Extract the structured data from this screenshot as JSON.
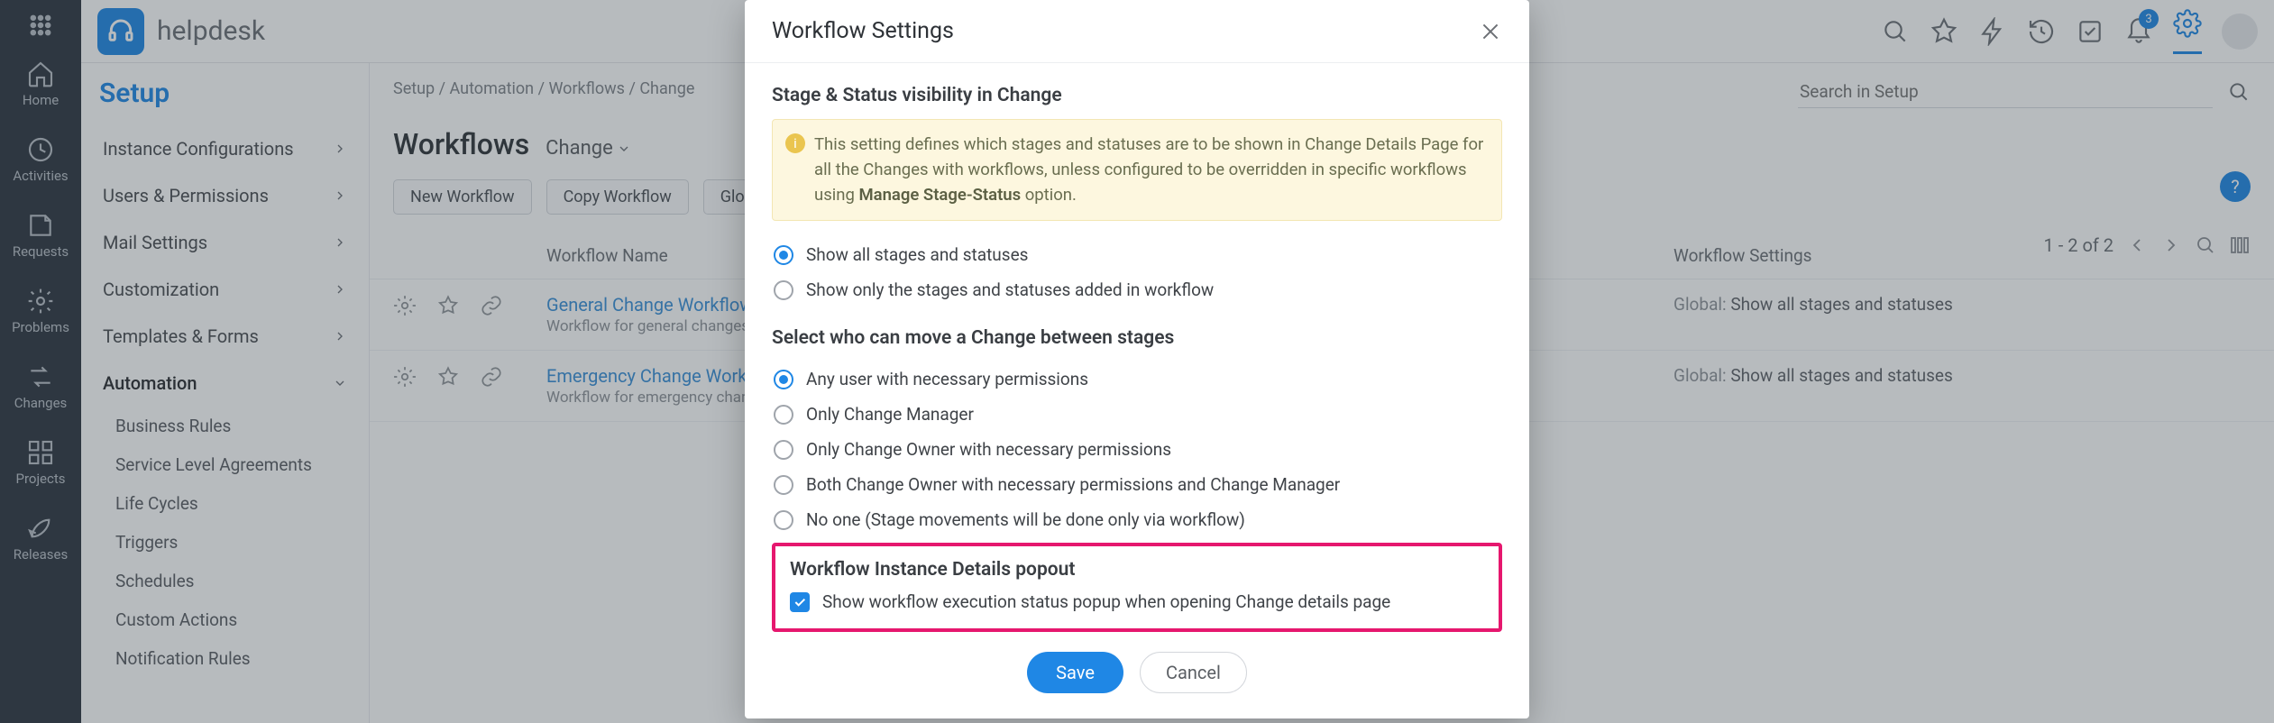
{
  "app": {
    "name": "helpdesk",
    "notif_count": "3"
  },
  "rail": {
    "items": [
      {
        "label": "Home"
      },
      {
        "label": "Activities"
      },
      {
        "label": "Requests"
      },
      {
        "label": "Problems"
      },
      {
        "label": "Changes"
      },
      {
        "label": "Projects"
      },
      {
        "label": "Releases"
      }
    ]
  },
  "sidebar": {
    "title": "Setup",
    "groups": [
      {
        "label": "Instance Configurations"
      },
      {
        "label": "Users & Permissions"
      },
      {
        "label": "Mail Settings"
      },
      {
        "label": "Customization"
      },
      {
        "label": "Templates & Forms"
      },
      {
        "label": "Automation"
      }
    ],
    "subitems": [
      "Business Rules",
      "Service Level Agreements",
      "Life Cycles",
      "Triggers",
      "Schedules",
      "Custom Actions",
      "Notification Rules"
    ]
  },
  "crumbs": {
    "a": "Setup",
    "b": "Automation",
    "c": "Workflows",
    "d": "Change"
  },
  "search": {
    "placeholder": "Search in Setup"
  },
  "page": {
    "title": "Workflows",
    "selector": "Change",
    "btn_new": "New Workflow",
    "btn_copy": "Copy Workflow",
    "btn_global": "Global",
    "pager": "1 - 2 of 2",
    "col_name": "Workflow Name",
    "col_settings": "Workflow Settings",
    "help": "?"
  },
  "rows": [
    {
      "title": "General Change Workflow",
      "desc": "Workflow for general changes",
      "scope": "Global:",
      "setting": "Show all stages and statuses",
      "starred": true
    },
    {
      "title": "Emergency Change Workflow",
      "desc": "Workflow for emergency changes",
      "scope": "Global:",
      "setting": "Show all stages and statuses",
      "starred": false
    }
  ],
  "modal": {
    "title": "Workflow Settings",
    "sect1": "Stage & Status visibility in Change",
    "info_a": "This setting defines which stages and statuses are to be shown in Change Details Page for all the Changes with workflows, unless configured to be overridden in specific workflows using ",
    "info_b": "Manage Stage-Status",
    "info_c": " option.",
    "vis_opts": [
      "Show all stages and statuses",
      "Show only the stages and statuses added in workflow"
    ],
    "sect2": "Select who can move a Change between stages",
    "move_opts": [
      "Any user with necessary permissions",
      "Only Change Manager",
      "Only Change Owner with necessary permissions",
      "Both Change Owner with necessary permissions and Change Manager",
      "No one (Stage movements will be done only via workflow)"
    ],
    "sect3": "Workflow Instance Details popout",
    "chk_label": "Show workflow execution status popup when opening Change details page",
    "save": "Save",
    "cancel": "Cancel"
  }
}
